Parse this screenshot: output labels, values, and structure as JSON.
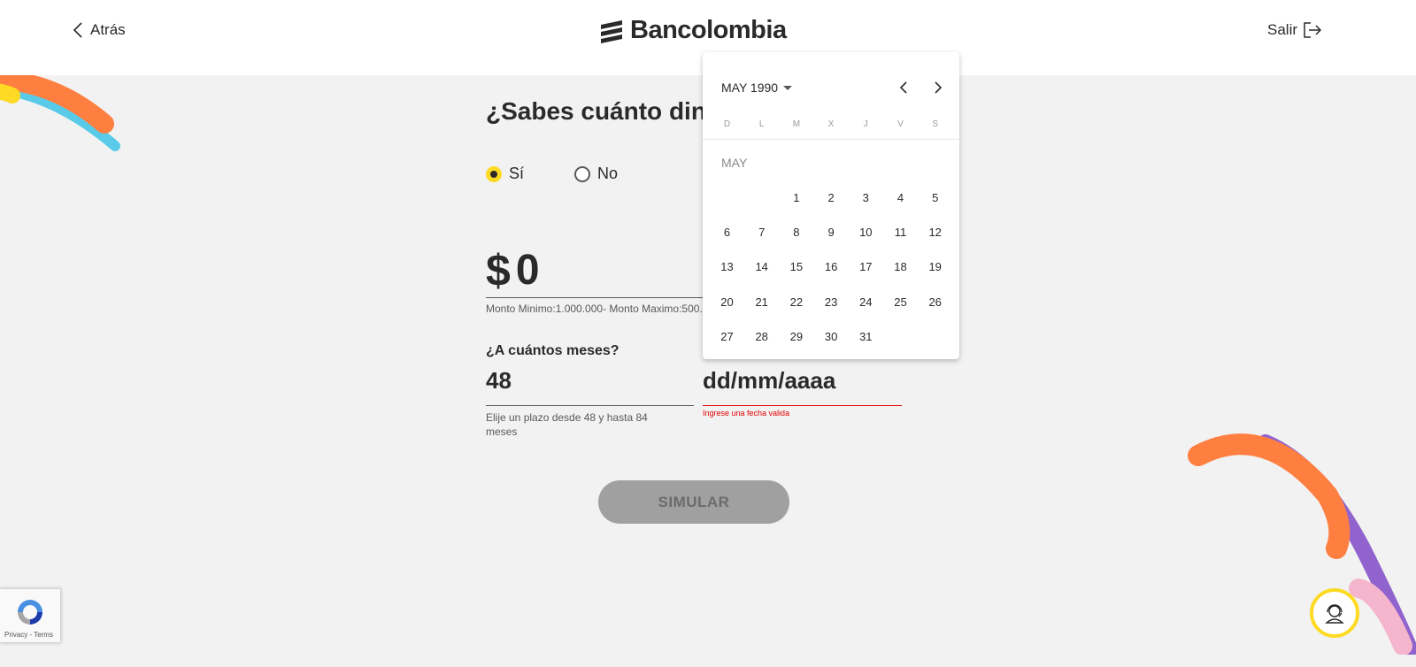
{
  "header": {
    "back_label": "Atrás",
    "brand": "Bancolombia",
    "exit_label": "Salir"
  },
  "form": {
    "question": "¿Sabes cuánto dinero necesitas?",
    "options": [
      {
        "label": "Sí",
        "checked": true
      },
      {
        "label": "No",
        "checked": false
      }
    ],
    "amount": {
      "currency": "$",
      "value": "0",
      "hint": "Monto Minimo:1.000.000- Monto Maximo:500.000.000"
    },
    "months": {
      "label": "¿A cuántos meses?",
      "value": "48",
      "hint": "Elije un plazo desde 48 y hasta 84 meses"
    },
    "date": {
      "placeholder": "dd/mm/aaaa",
      "error": "Ingrese una fecha valida"
    },
    "submit_label": "SIMULAR"
  },
  "calendar": {
    "header": "MAY 1990",
    "month_label": "MAY",
    "weekdays": [
      "D",
      "L",
      "M",
      "X",
      "J",
      "V",
      "S"
    ],
    "first_weekday_index": 2,
    "days": 31
  },
  "recaptcha": {
    "terms": "Privacy - Terms"
  },
  "colors": {
    "brand_yellow": "#fdda24",
    "error_red": "#e20201",
    "deco_orange": "#ff7f41",
    "deco_blue": "#59cbe8",
    "deco_purple": "#9063cd",
    "deco_pink": "#f5b6cd"
  }
}
